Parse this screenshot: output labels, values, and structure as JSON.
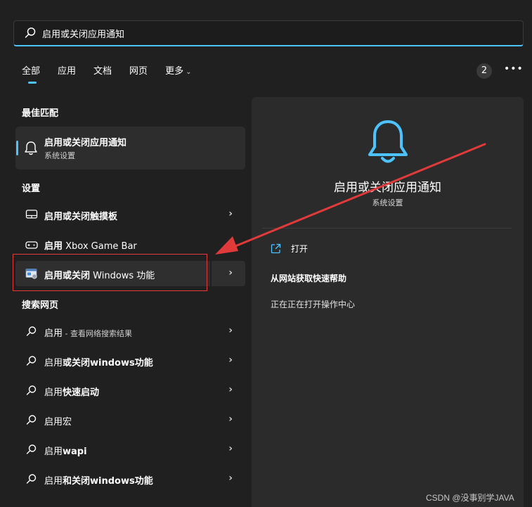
{
  "search": {
    "value": "启用或关闭应用通知"
  },
  "tabs": [
    {
      "label": "全部",
      "active": true
    },
    {
      "label": "应用"
    },
    {
      "label": "文档"
    },
    {
      "label": "网页"
    },
    {
      "label": "更多"
    }
  ],
  "header": {
    "count_badge": "2",
    "more_label": "•••"
  },
  "best_match": {
    "heading": "最佳匹配",
    "title": "启用或关闭应用通知",
    "subtitle": "系统设置",
    "icon": "bell-icon"
  },
  "settings": {
    "heading": "设置",
    "items": [
      {
        "prefix": "启用或关闭触摸板",
        "rest": "",
        "icon": "touchpad-icon"
      },
      {
        "prefix": "启用",
        "rest": " Xbox Game Bar",
        "icon": "gamebar-icon"
      },
      {
        "prefix": "启用或关闭",
        "rest": " Windows 功能",
        "icon": "windows-features-icon"
      }
    ]
  },
  "web": {
    "heading": "搜索网页",
    "items": [
      {
        "bold": "",
        "plain": "启用",
        "small": " - 查看网络搜索结果"
      },
      {
        "bold": "或关闭windows功能",
        "plain": "启用",
        "small": ""
      },
      {
        "bold": "快速启动",
        "plain": "启用",
        "small": ""
      },
      {
        "bold": "",
        "plain": "启用宏",
        "small": ""
      },
      {
        "bold": "wapi",
        "plain": "启用",
        "small": ""
      },
      {
        "bold": "和关闭windows功能",
        "plain": "启用",
        "small": ""
      }
    ]
  },
  "preview": {
    "title": "启用或关闭应用通知",
    "subtitle": "系统设置",
    "open_label": "打开",
    "help_label": "从网站获取快速帮助",
    "status_text": "正在正在打开操作中心"
  },
  "colors": {
    "accent": "#4cc2ff",
    "annotation": "#e03a3a"
  },
  "watermark": "CSDN @没事别学JAVA"
}
